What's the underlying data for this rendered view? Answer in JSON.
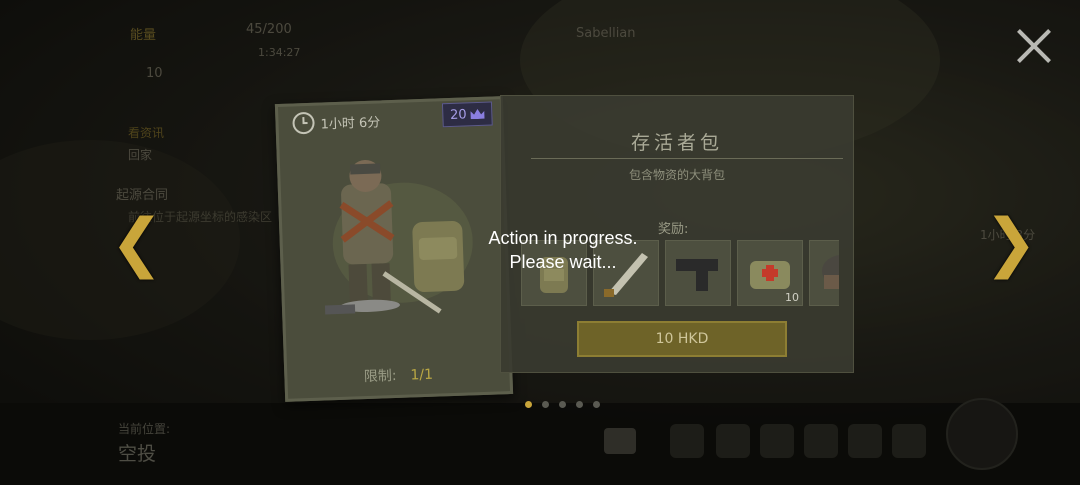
{
  "hud": {
    "resource_label": "能量",
    "resource_count": "45/200",
    "resource_sub": "1:34:27",
    "level": "10",
    "player_name": "Sabellian",
    "quest_heading": "看资讯",
    "quest_sub": "回家",
    "task_title": "起源合同",
    "task_desc": "前往位于起源坐标的感染区",
    "right_timer": "1小时 3分"
  },
  "card": {
    "timer": "1小时 6分",
    "gem_count": "20",
    "limit_label": "限制:",
    "limit_value": "1/1",
    "icons": {
      "timer": "clock-icon",
      "gem": "crown-icon"
    }
  },
  "panel": {
    "title": "存活者包",
    "subtitle": "包含物资的大背包",
    "rewards_label": "奖励:",
    "rewards": [
      {
        "name": "backpack",
        "count": ""
      },
      {
        "name": "machete",
        "count": ""
      },
      {
        "name": "pistol",
        "count": ""
      },
      {
        "name": "medkit",
        "count": "10"
      },
      {
        "name": "helmet",
        "count": ""
      }
    ],
    "price_button": "10 HKD"
  },
  "pagination": {
    "count": 5,
    "active": 0
  },
  "overlay": {
    "line1": "Action in progress.",
    "line2": "Please wait..."
  },
  "location": {
    "label": "当前位置:",
    "value": "空投"
  },
  "colors": {
    "accent": "#c9a53a",
    "button_bg": "#6e6328",
    "panel_bg": "#3a3b30"
  }
}
